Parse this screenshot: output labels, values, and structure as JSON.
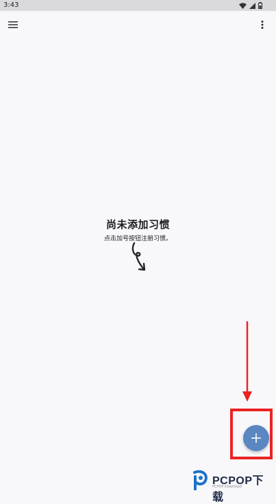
{
  "status_bar": {
    "time": "3:43",
    "icons": [
      "wifi-icon",
      "signal-icon",
      "battery-icon"
    ]
  },
  "app_bar": {
    "menu_icon": "hamburger-menu-icon",
    "more_icon": "more-vert-icon"
  },
  "empty_state": {
    "title": "尚未添加习惯",
    "subtitle": "点击加号按钮注册习惯。"
  },
  "fab": {
    "icon": "plus-icon",
    "color": "#5a86c1"
  },
  "annotation": {
    "highlight_color": "#ea2323"
  },
  "watermark": {
    "brand": "PCPOP下载",
    "sub": "PCPOP Download"
  }
}
